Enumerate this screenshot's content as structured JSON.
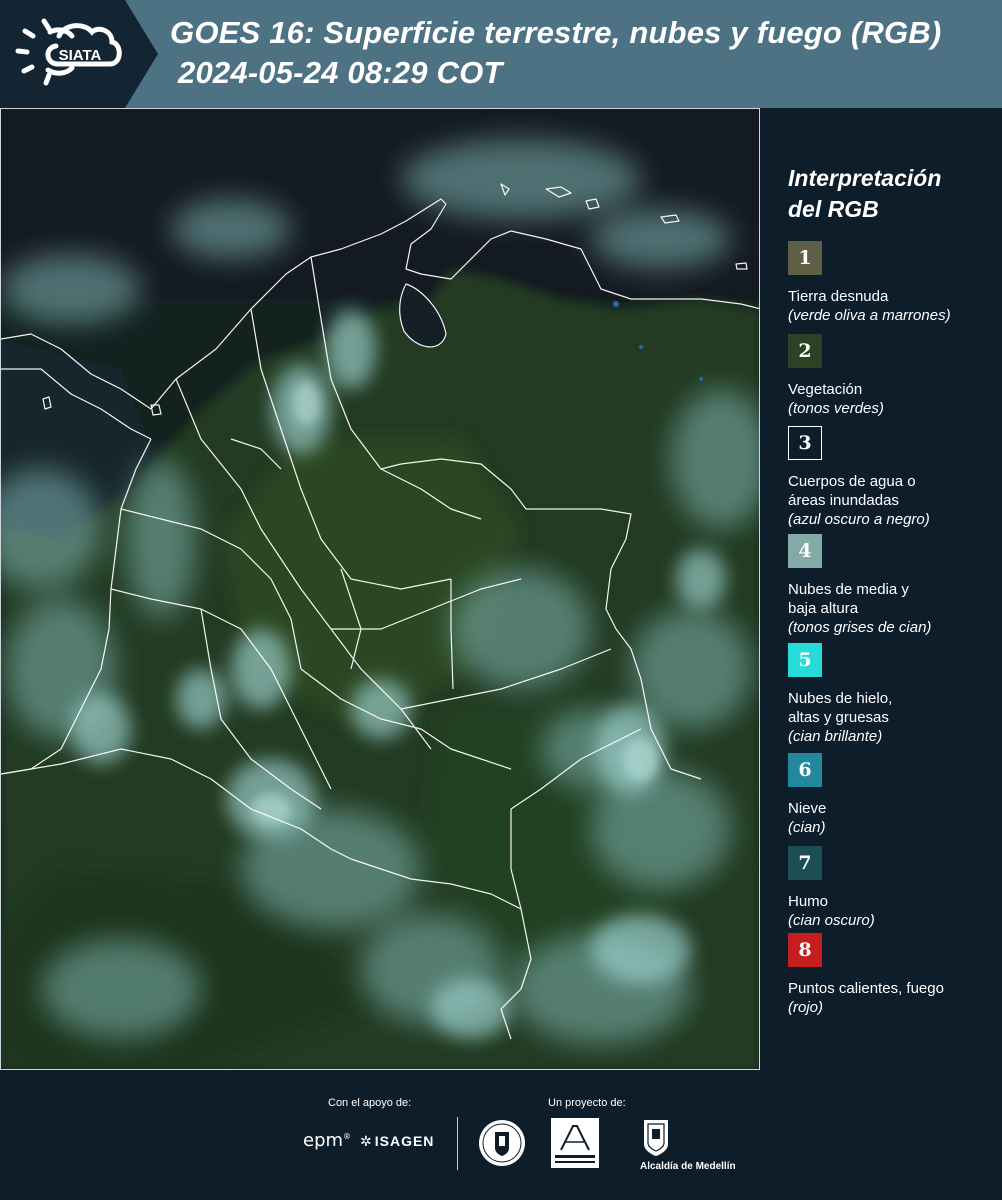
{
  "header": {
    "logo_text": "SIATA",
    "title_line1": "GOES 16: Superficie terrestre, nubes y fuego (RGB)",
    "title_line2": "2024-05-24 08:29 COT"
  },
  "legend": {
    "title_line1": "Interpretación",
    "title_line2": "del RGB",
    "items": [
      {
        "number": "1",
        "color": "#5e5f44",
        "label_lines": [
          "Tierra desnuda"
        ],
        "note": "(verde oliva a marrones)"
      },
      {
        "number": "2",
        "color": "#2d4224",
        "label_lines": [
          "Vegetación"
        ],
        "note": "(tonos verdes)"
      },
      {
        "number": "3",
        "color": "#0d1d2a",
        "border": "#ffffff",
        "label_lines": [
          "Cuerpos de agua o",
          "áreas inundadas"
        ],
        "note": "(azul oscuro a negro)"
      },
      {
        "number": "4",
        "color": "#84aaa8",
        "label_lines": [
          "Nubes de media y",
          "baja altura"
        ],
        "note": "(tonos grises de cian)"
      },
      {
        "number": "5",
        "color": "#27dcd8",
        "label_lines": [
          "Nubes de hielo,",
          "altas y gruesas"
        ],
        "note": "(cian brillante)"
      },
      {
        "number": "6",
        "color": "#24889d",
        "label_lines": [
          "Nieve"
        ],
        "note": "(cian)"
      },
      {
        "number": "7",
        "color": "#1c4f54",
        "label_lines": [
          "Humo"
        ],
        "note": "(cian oscuro)"
      },
      {
        "number": "8",
        "color": "#c41e1e",
        "label_lines": [
          "Puntos calientes, fuego"
        ],
        "note": "(rojo)"
      }
    ]
  },
  "footer": {
    "support_label": "Con el apoyo de:",
    "project_label": "Un proyecto de:",
    "sponsors": [
      "epm",
      "ISAGEN"
    ],
    "partners": [
      "Área Metropolitana Valle de Aburrá",
      "Alcaldía de Medellín"
    ],
    "epm_text": "epm",
    "isagen_text": "ISAGEN",
    "alcaldia_text": "Alcaldía de Medellín"
  },
  "colors": {
    "header_bg": "#4c7283",
    "header_dark": "#132533",
    "panel_bg": "#0d1d2a"
  }
}
